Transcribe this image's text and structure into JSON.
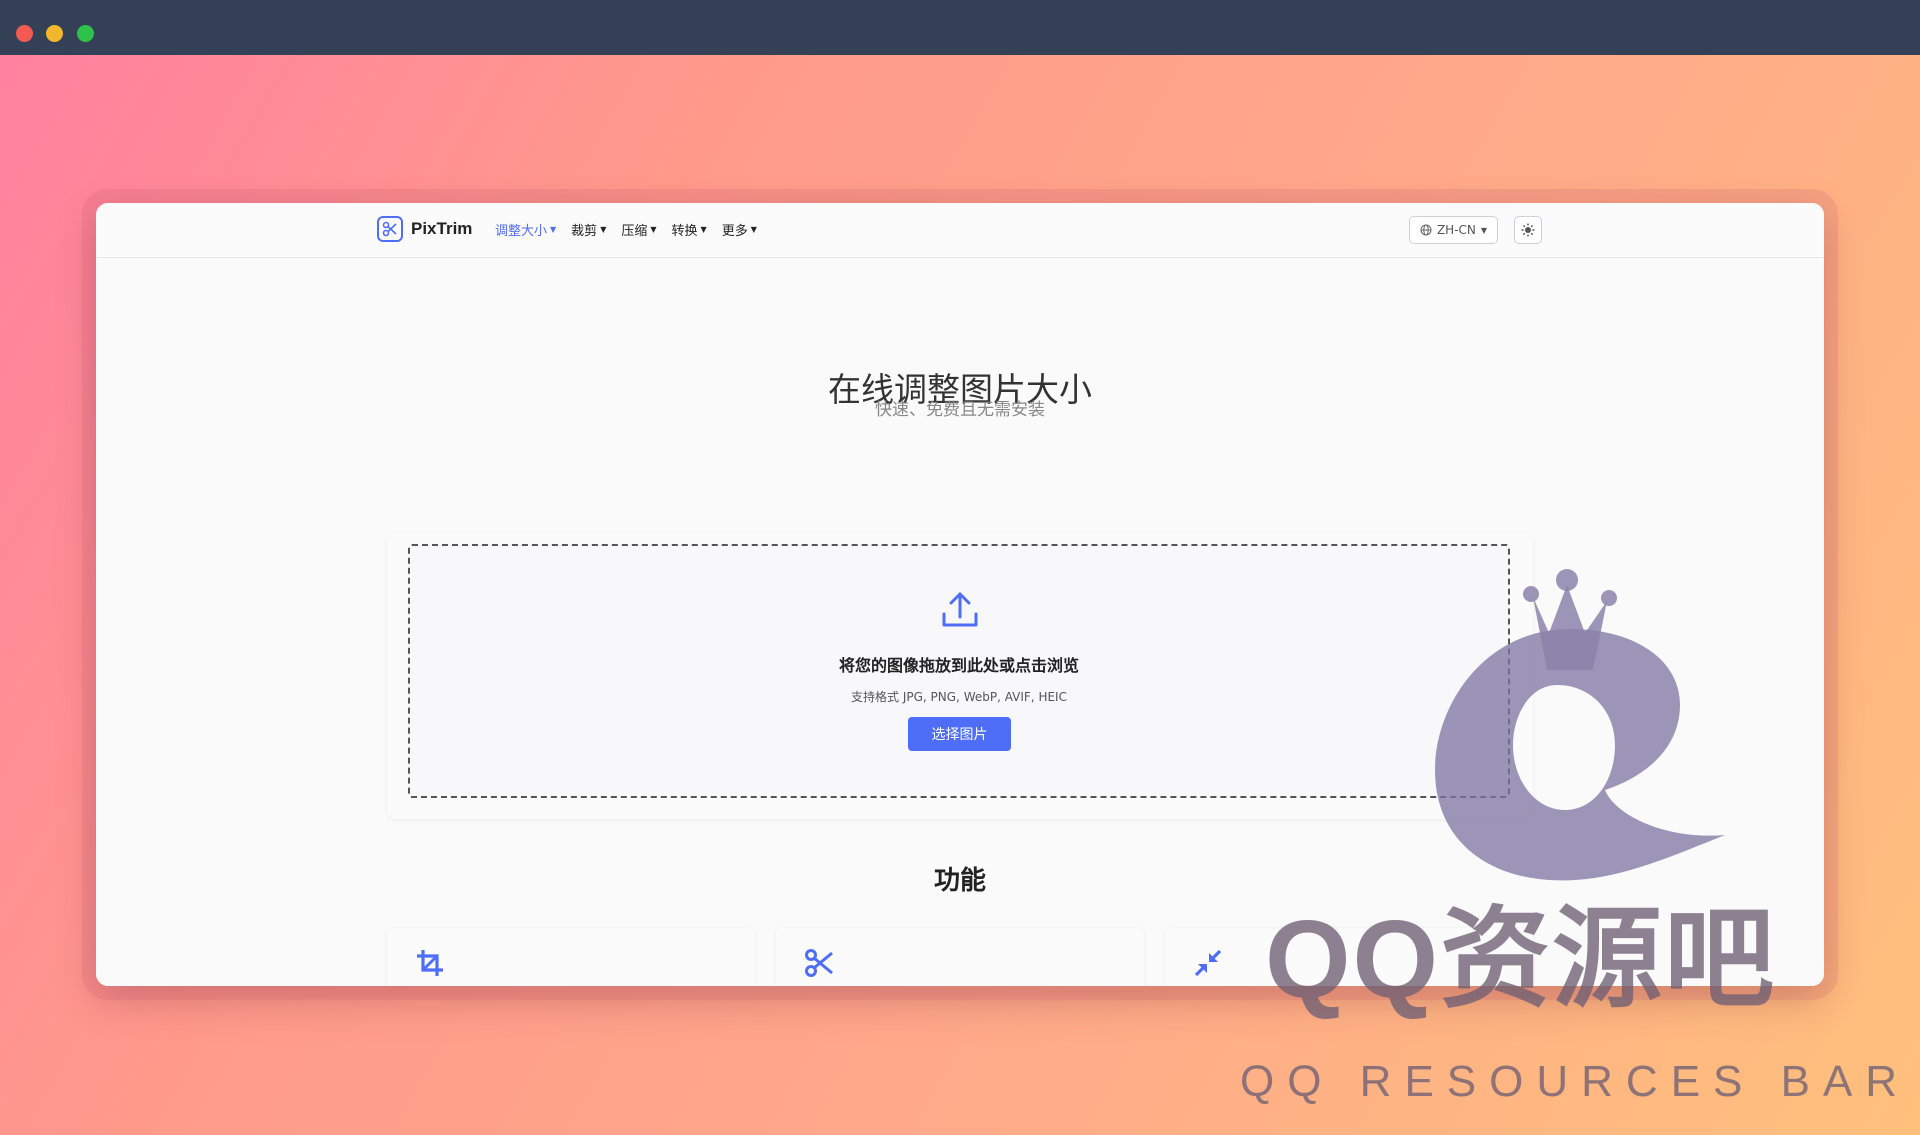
{
  "app": {
    "name": "PixTrim"
  },
  "nav": {
    "menu": [
      {
        "label": "调整大小",
        "active": true
      },
      {
        "label": "裁剪",
        "active": false
      },
      {
        "label": "压缩",
        "active": false
      },
      {
        "label": "转换",
        "active": false
      },
      {
        "label": "更多",
        "active": false
      }
    ],
    "language": "ZH-CN"
  },
  "hero": {
    "title": "在线调整图片大小",
    "subtitle": "快速、免费且无需安装"
  },
  "upload": {
    "title": "将您的图像拖放到此处或点击浏览",
    "formats": "支持格式 JPG, PNG, WebP, AVIF, HEIC",
    "button": "选择图片"
  },
  "features": {
    "heading": "功能",
    "icons": [
      "crop-icon",
      "scissors-icon",
      "compress-icon"
    ]
  },
  "watermark": {
    "title": "QQ资源吧",
    "subtitle": "QQ RESOURCES BAR"
  },
  "colors": {
    "accent": "#4f6ef7",
    "window_bar": "#334055"
  }
}
